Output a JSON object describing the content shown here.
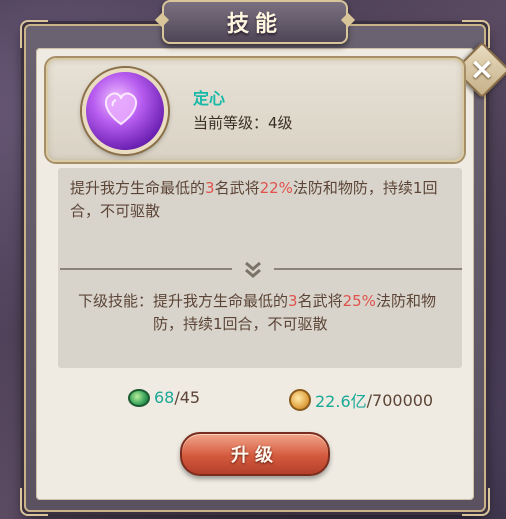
{
  "title": "技能",
  "close_icon": "close-icon",
  "skill": {
    "name": "定心",
    "level_label": "当前等级：",
    "level_value": "4级",
    "icon": "purple-heart-gem-icon"
  },
  "current_desc": {
    "part1": "提升我方生命最低的",
    "num": "3",
    "part2": "名武将",
    "percent": "22%",
    "part3": "法防和物防，持续1回合，不可驱散"
  },
  "next": {
    "label": "下级技能：",
    "part1": "提升我方生命最低的",
    "num": "3",
    "part2": "名武将",
    "percent": "25%",
    "part3": "法防和物防，持续1回合，不可驱散"
  },
  "cost": {
    "jade": {
      "current": "68",
      "sep": "/",
      "required": "45"
    },
    "coin": {
      "current": "22.6亿",
      "sep": "/",
      "required": "700000"
    }
  },
  "upgrade_label": "升级",
  "colors": {
    "accent_teal": "#1aa996",
    "highlight_red": "#e0524b",
    "button": "#d45a3e"
  }
}
